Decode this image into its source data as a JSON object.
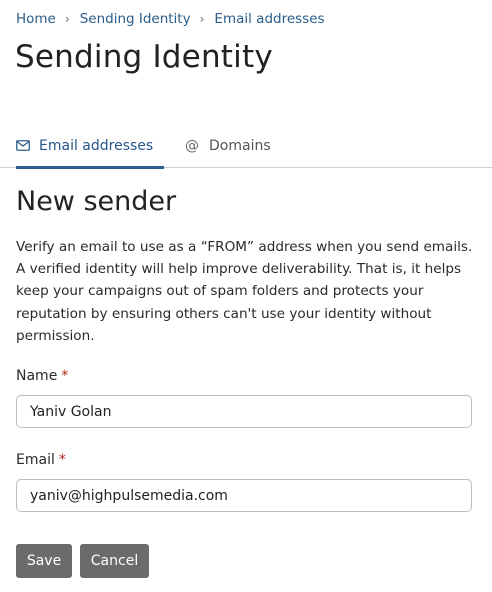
{
  "breadcrumb": {
    "items": [
      "Home",
      "Sending Identity",
      "Email addresses"
    ],
    "separator": "›"
  },
  "page_title": "Sending Identity",
  "tabs": [
    {
      "label": "Email addresses",
      "icon": "envelope-icon",
      "active": true
    },
    {
      "label": "Domains",
      "icon": "at-sign-icon",
      "active": false
    }
  ],
  "tab_icons": {
    "at": "@"
  },
  "section_title": "New sender",
  "description": "Verify an email to use as a “FROM” address when you send emails. A verified identity will help improve deliverability. That is, it helps keep your campaigns out of spam folders and protects your reputation by ensuring others can't use your identity without permission.",
  "form": {
    "name": {
      "label": "Name",
      "required_mark": "*",
      "value": "Yaniv Golan"
    },
    "email": {
      "label": "Email",
      "required_mark": "*",
      "value": "yaniv@highpulsemedia.com"
    }
  },
  "buttons": {
    "save": "Save",
    "cancel": "Cancel"
  },
  "colors": {
    "link": "#2a5d8a",
    "active_tab": "#2f5e8e",
    "required": "#b3261e",
    "button_bg": "#6b6b6b"
  }
}
